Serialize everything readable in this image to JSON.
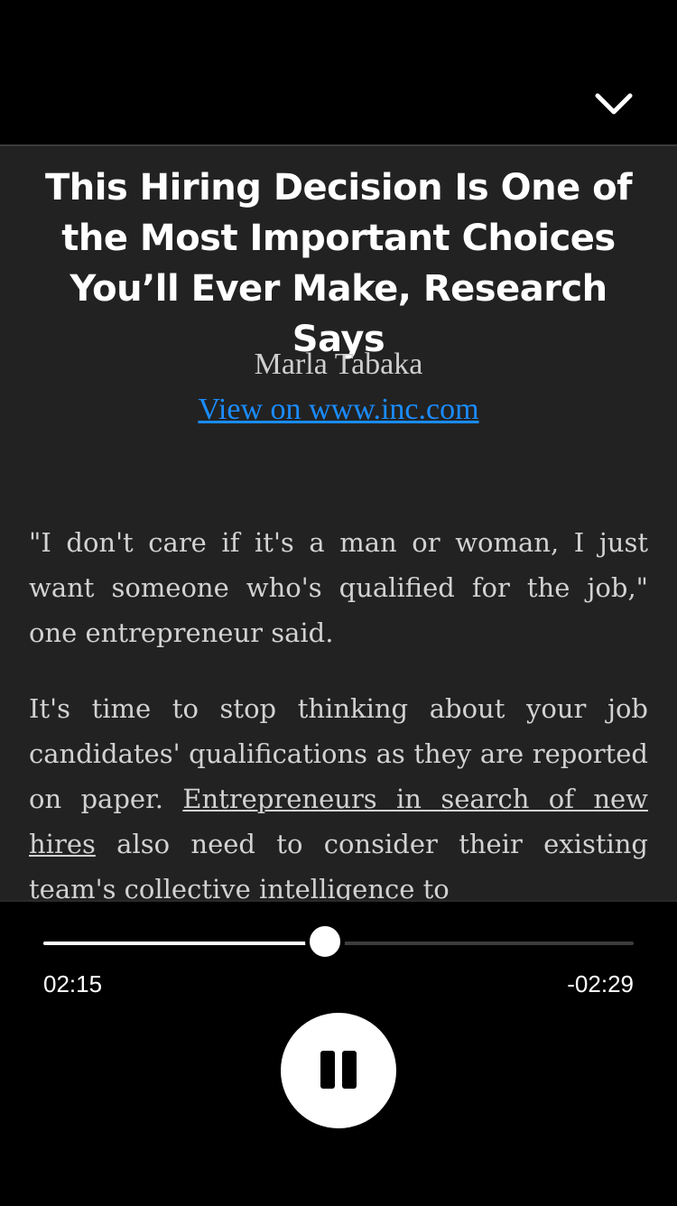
{
  "header": {
    "collapse_icon": "chevron-down-icon"
  },
  "article": {
    "title": "This Hiring Decision Is One of the Most Important Choices You’ll Ever Make, Research Says",
    "author": "Marla Tabaka",
    "source_link": "View on www.inc.com",
    "paragraphs": [
      {
        "text": "\"I don't care if it's a man or woman, I just want someone who's qualified for the job,\" one entrepreneur said."
      },
      {
        "text_before": "It's time to stop thinking about your job candidates' qualifications as they are reported on paper. ",
        "link": "Entrepreneurs in search of new hires",
        "text_after": " also need to consider their existing team's collective intelligence to"
      }
    ]
  },
  "player": {
    "progress": 0.477,
    "elapsed": "02:15",
    "remaining": "-02:29",
    "control_icon": "pause-icon"
  },
  "colors": {
    "link": "#1a8cff",
    "background": "#222222",
    "player_bg": "#000000"
  }
}
